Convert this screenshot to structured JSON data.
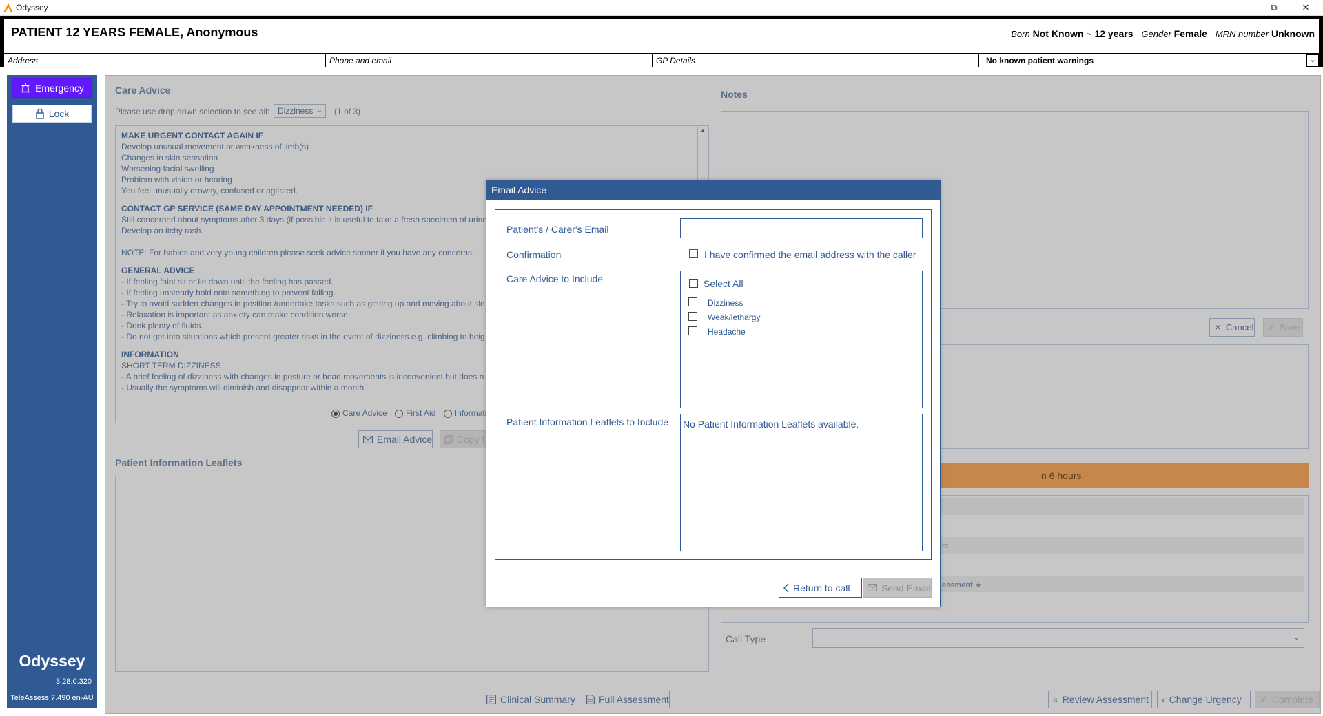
{
  "window": {
    "title": "Odyssey",
    "controls": {
      "minimize": "—",
      "restore": "⧉",
      "close": "✕"
    }
  },
  "patient": {
    "name": "PATIENT 12 YEARS FEMALE, Anonymous",
    "born_label": "Born",
    "born_value": "Not Known ~ 12 years",
    "gender_label": "Gender",
    "gender_value": "Female",
    "mrn_label": "MRN number",
    "mrn_value": "Unknown",
    "address_label": "Address",
    "phone_label": "Phone and email",
    "gp_label": "GP Details",
    "warnings": "No known patient warnings"
  },
  "sidebar": {
    "emergency_label": "Emergency",
    "lock_label": "Lock",
    "brand": "Odyssey",
    "version": "3.28.0.320",
    "teleassess": "TeleAssess 7.490 en-AU"
  },
  "care_advice": {
    "title": "Care Advice",
    "dropdown_prompt": "Please use drop down selection to see all:",
    "dropdown_value": "Dizziness",
    "page_indicator": "(1 of 3)",
    "sections": [
      {
        "heading": "MAKE URGENT CONTACT AGAIN IF",
        "lines": [
          "Develop unusual movement or weakness of limb(s)",
          "Changes in skin sensation",
          "Worsening facial swelling",
          "Problem with vision or hearing",
          "You feel unusually drowsy, confused or agitated."
        ]
      },
      {
        "heading": "CONTACT GP SERVICE (SAME DAY APPOINTMENT NEEDED) IF",
        "lines": [
          "Still concerned about symptoms after 3 days (if possible it is useful to take a fresh specimen of urine",
          "Develop an itchy rash.",
          "",
          "NOTE: For babies and very young children please seek advice sooner if you have any concerns."
        ]
      },
      {
        "heading": "GENERAL ADVICE",
        "lines": [
          "- If feeling faint sit or lie down until the feeling has passed.",
          "- If feeling unsteady hold onto something to prevent falling.",
          "- Try to avoid sudden changes in position /undertake tasks such as getting up and moving about slo",
          "- Relaxation is important as anxiety can make condition worse.",
          "- Drink plenty of fluids.",
          "- Do not get into situations which present greater risks in the event of dizziness e.g. climbing to heig"
        ]
      },
      {
        "heading": "INFORMATION",
        "lines": [
          "SHORT TERM DIZZINESS",
          "- A brief feeling of dizziness with changes in posture or head movements is inconvenient but does n",
          "- Usually the symptoms will diminish and disappear within a month."
        ]
      }
    ],
    "radio_care": "Care Advice",
    "radio_first_aid": "First Aid",
    "radio_info": "Informati",
    "email_button": "Email Advice",
    "copy_button": "Copy t"
  },
  "leaflets": {
    "title": "Patient Information Leaflets"
  },
  "notes": {
    "title": "Notes",
    "cancel_label": "Cancel",
    "save_label": "Save"
  },
  "right_panel": {
    "urgency_text": "n 6 hours",
    "faint_text_1": "nt",
    "faint_text_2": "essment ★",
    "call_type_label": "Call Type"
  },
  "bottom_bar": {
    "clinical_summary": "Clinical Summary",
    "full_assessment": "Full Assessment",
    "review_assessment": "Review Assessment",
    "change_urgency": "Change Urgency",
    "complete": "Complete"
  },
  "email_modal": {
    "title": "Email Advice",
    "email_label": "Patient's / Carer's Email",
    "email_value": "",
    "confirmation_label": "Confirmation",
    "confirmation_text": "I have confirmed the email address with the caller",
    "care_include_label": "Care Advice to Include",
    "select_all": "Select All",
    "items": [
      "Dizziness",
      "Weak/lethargy",
      "Headache"
    ],
    "leaflets_label": "Patient Information Leaflets to Include",
    "leaflets_value": "No Patient Information Leaflets available.",
    "return_button": "Return to call",
    "send_button": "Send Email"
  },
  "colors": {
    "primary": "#2f5a93",
    "emergency": "#6418ff",
    "urgency": "#c8874a",
    "overlay": "#c7c7c7"
  }
}
